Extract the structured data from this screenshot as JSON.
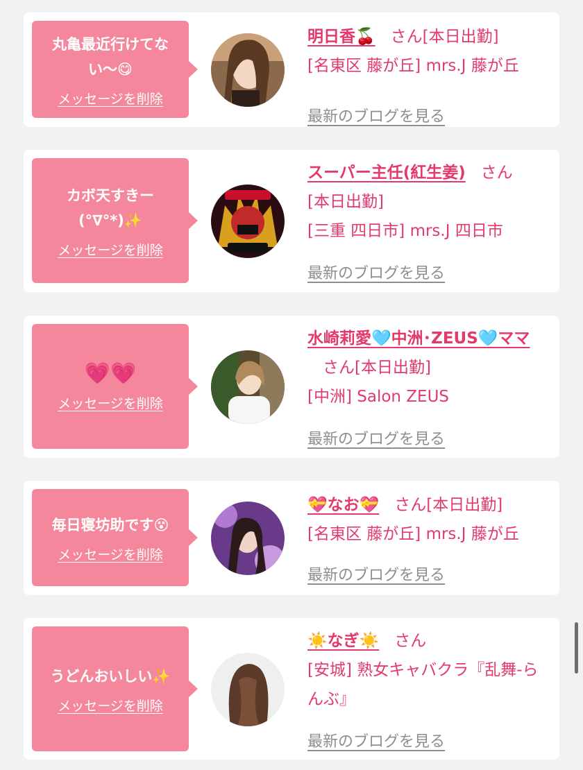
{
  "delete_label": "メッセージを削除",
  "blog_label": "最新のブログを見る",
  "san_label": "さん",
  "cards": [
    {
      "message_lines": [
        "丸亀最近行けてな",
        "い〜😋"
      ],
      "name": "明日香🍒",
      "info_lines": [
        "[本日出勤]",
        "[名東区 藤が丘] mrs.J 藤が丘"
      ],
      "avatar": "avatar-woman-photo"
    },
    {
      "message_lines": [
        "カボ天すきー",
        "(°∇°*)✨"
      ],
      "name": "スーパー主任(紅生姜)",
      "info_lines": [
        "[本日出勤]",
        "[三重 四日市] mrs.J 四日市"
      ],
      "avatar": "avatar-anime-character"
    },
    {
      "message_lines": [
        "💗💗"
      ],
      "name": "水崎莉愛🩵中洲･ZEUS🩵ママ",
      "info_lines": [
        "[本日出勤]",
        "[中洲] Salon ZEUS"
      ],
      "avatar": "avatar-woman-photo"
    },
    {
      "message_lines": [
        "毎日寝坊助です😵"
      ],
      "name": "💝なお💝",
      "info_lines": [
        "[本日出勤]",
        "[名東区 藤が丘] mrs.J 藤が丘"
      ],
      "avatar": "avatar-woman-photo"
    },
    {
      "message_lines": [
        "うどんおいしい✨"
      ],
      "name": "☀️なぎ☀️",
      "info_lines": [
        "",
        "[安城] 熟女キャバクラ『乱舞-らんぶ』"
      ],
      "avatar": "avatar-woman-hair-photo"
    }
  ]
}
